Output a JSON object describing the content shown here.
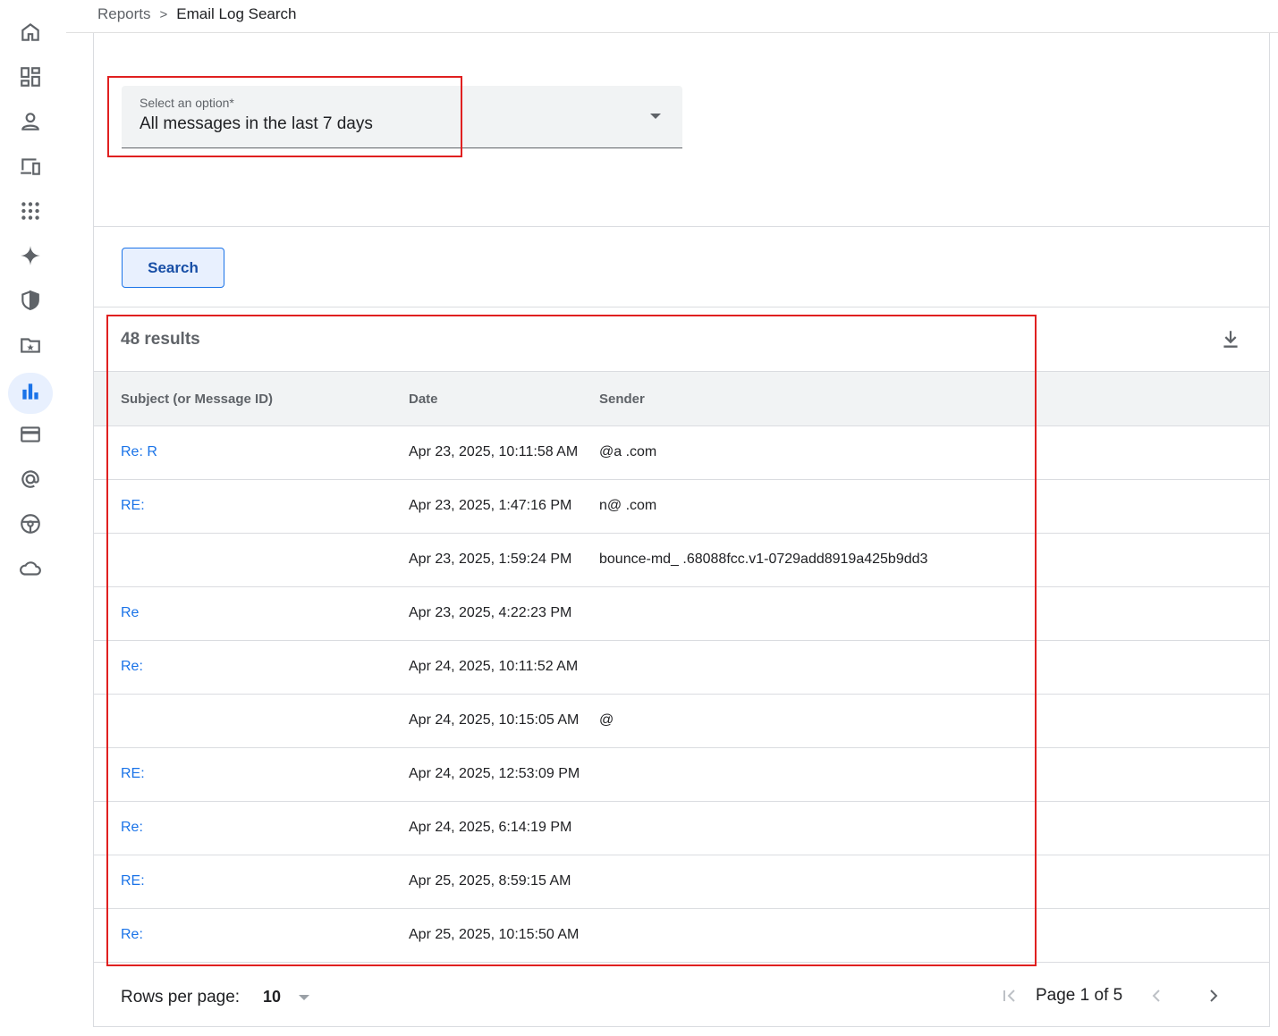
{
  "breadcrumb": {
    "parent": "Reports",
    "separator": ">",
    "current": "Email Log Search"
  },
  "nav": {
    "items": [
      {
        "icon": "home-icon",
        "active": false
      },
      {
        "icon": "dashboard-icon",
        "active": false
      },
      {
        "icon": "person-icon",
        "active": false
      },
      {
        "icon": "devices-icon",
        "active": false
      },
      {
        "icon": "apps-grid-icon",
        "active": false
      },
      {
        "icon": "sparkle-icon",
        "active": false
      },
      {
        "icon": "security-shield-icon",
        "active": false
      },
      {
        "icon": "folder-star-icon",
        "active": false
      },
      {
        "icon": "reporting-bar-chart-icon",
        "active": true
      },
      {
        "icon": "billing-card-icon",
        "active": false
      },
      {
        "icon": "account-at-icon",
        "active": false
      },
      {
        "icon": "rules-steering-icon",
        "active": false
      },
      {
        "icon": "cloud-icon",
        "active": false
      }
    ]
  },
  "filter": {
    "label": "Select an option*",
    "value": "All messages in the last 7 days"
  },
  "search_button": "Search",
  "results": {
    "count_text": "48 results"
  },
  "table": {
    "headers": {
      "subject": "Subject (or Message ID)",
      "date": "Date",
      "sender": "Sender"
    },
    "rows": [
      {
        "subject": "Re: R",
        "date": "Apr 23, 2025, 10:11:58 AM",
        "sender": "@a               .com"
      },
      {
        "subject": "RE:",
        "date": "Apr 23, 2025, 1:47:16 PM",
        "sender": "n@        .com"
      },
      {
        "subject": "",
        "date": "Apr 23, 2025, 1:59:24 PM",
        "sender": "bounce-md_             .68088fcc.v1-0729add8919a425b9dd3"
      },
      {
        "subject": "Re",
        "date": "Apr 23, 2025, 4:22:23 PM",
        "sender": ""
      },
      {
        "subject": "Re:",
        "date": "Apr 24, 2025, 10:11:52 AM",
        "sender": ""
      },
      {
        "subject": "",
        "date": "Apr 24, 2025, 10:15:05 AM",
        "sender": "@"
      },
      {
        "subject": "RE:",
        "date": "Apr 24, 2025, 12:53:09 PM",
        "sender": ""
      },
      {
        "subject": "Re:",
        "date": "Apr 24, 2025, 6:14:19 PM",
        "sender": ""
      },
      {
        "subject": "RE:",
        "date": "Apr 25, 2025, 8:59:15 AM",
        "sender": ""
      },
      {
        "subject": "Re:",
        "date": "Apr 25, 2025, 10:15:50 AM",
        "sender": ""
      }
    ]
  },
  "pagination": {
    "rows_per_page_label": "Rows per page:",
    "rows_per_page_value": "10",
    "page_text": "Page 1 of 5"
  },
  "colors": {
    "accent": "#1a73e8",
    "annotation": "#e02020",
    "header_bg": "#f1f3f4"
  }
}
